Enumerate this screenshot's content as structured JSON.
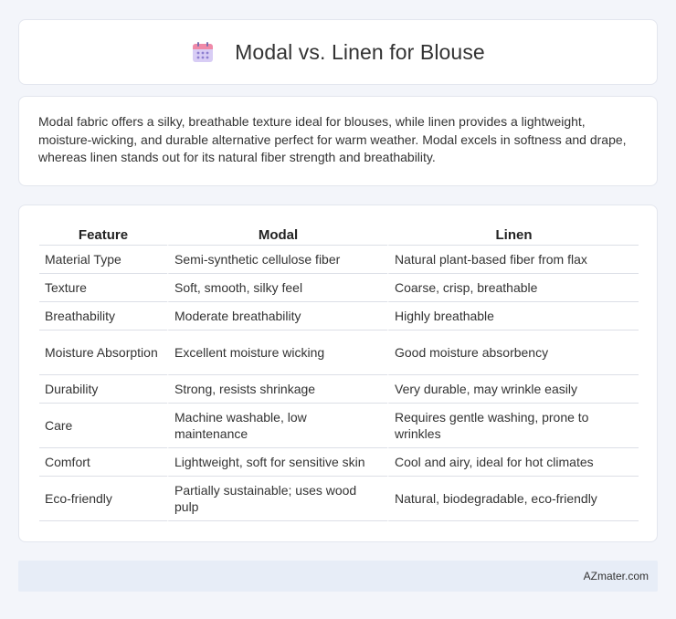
{
  "header": {
    "title": "Modal vs. Linen for Blouse",
    "icon": "calendar-icon"
  },
  "summary": {
    "text": "Modal fabric offers a silky, breathable texture ideal for blouses, while linen provides a lightweight, moisture-wicking, and durable alternative perfect for warm weather. Modal excels in softness and drape, whereas linen stands out for its natural fiber strength and breathability."
  },
  "table": {
    "headers": [
      "Feature",
      "Modal",
      "Linen"
    ],
    "rows": [
      [
        "Material Type",
        "Semi-synthetic cellulose fiber",
        "Natural plant-based fiber from flax"
      ],
      [
        "Texture",
        "Soft, smooth, silky feel",
        "Coarse, crisp, breathable"
      ],
      [
        "Breathability",
        "Moderate breathability",
        "Highly breathable"
      ],
      [
        "Moisture Absorption",
        "Excellent moisture wicking",
        "Good moisture absorbency"
      ],
      [
        "Durability",
        "Strong, resists shrinkage",
        "Very durable, may wrinkle easily"
      ],
      [
        "Care",
        "Machine washable, low maintenance",
        "Requires gentle washing, prone to wrinkles"
      ],
      [
        "Comfort",
        "Lightweight, soft for sensitive skin",
        "Cool and airy, ideal for hot climates"
      ],
      [
        "Eco-friendly",
        "Partially sustainable; uses wood pulp",
        "Natural, biodegradable, eco-friendly"
      ]
    ]
  },
  "footer": {
    "text": "AZmater.com"
  },
  "colors": {
    "background": "#f3f5fa",
    "card": "#ffffff",
    "footer_bar": "#e7edf7",
    "icon_top": "#f08aa8",
    "icon_body": "#c9b8f0"
  }
}
